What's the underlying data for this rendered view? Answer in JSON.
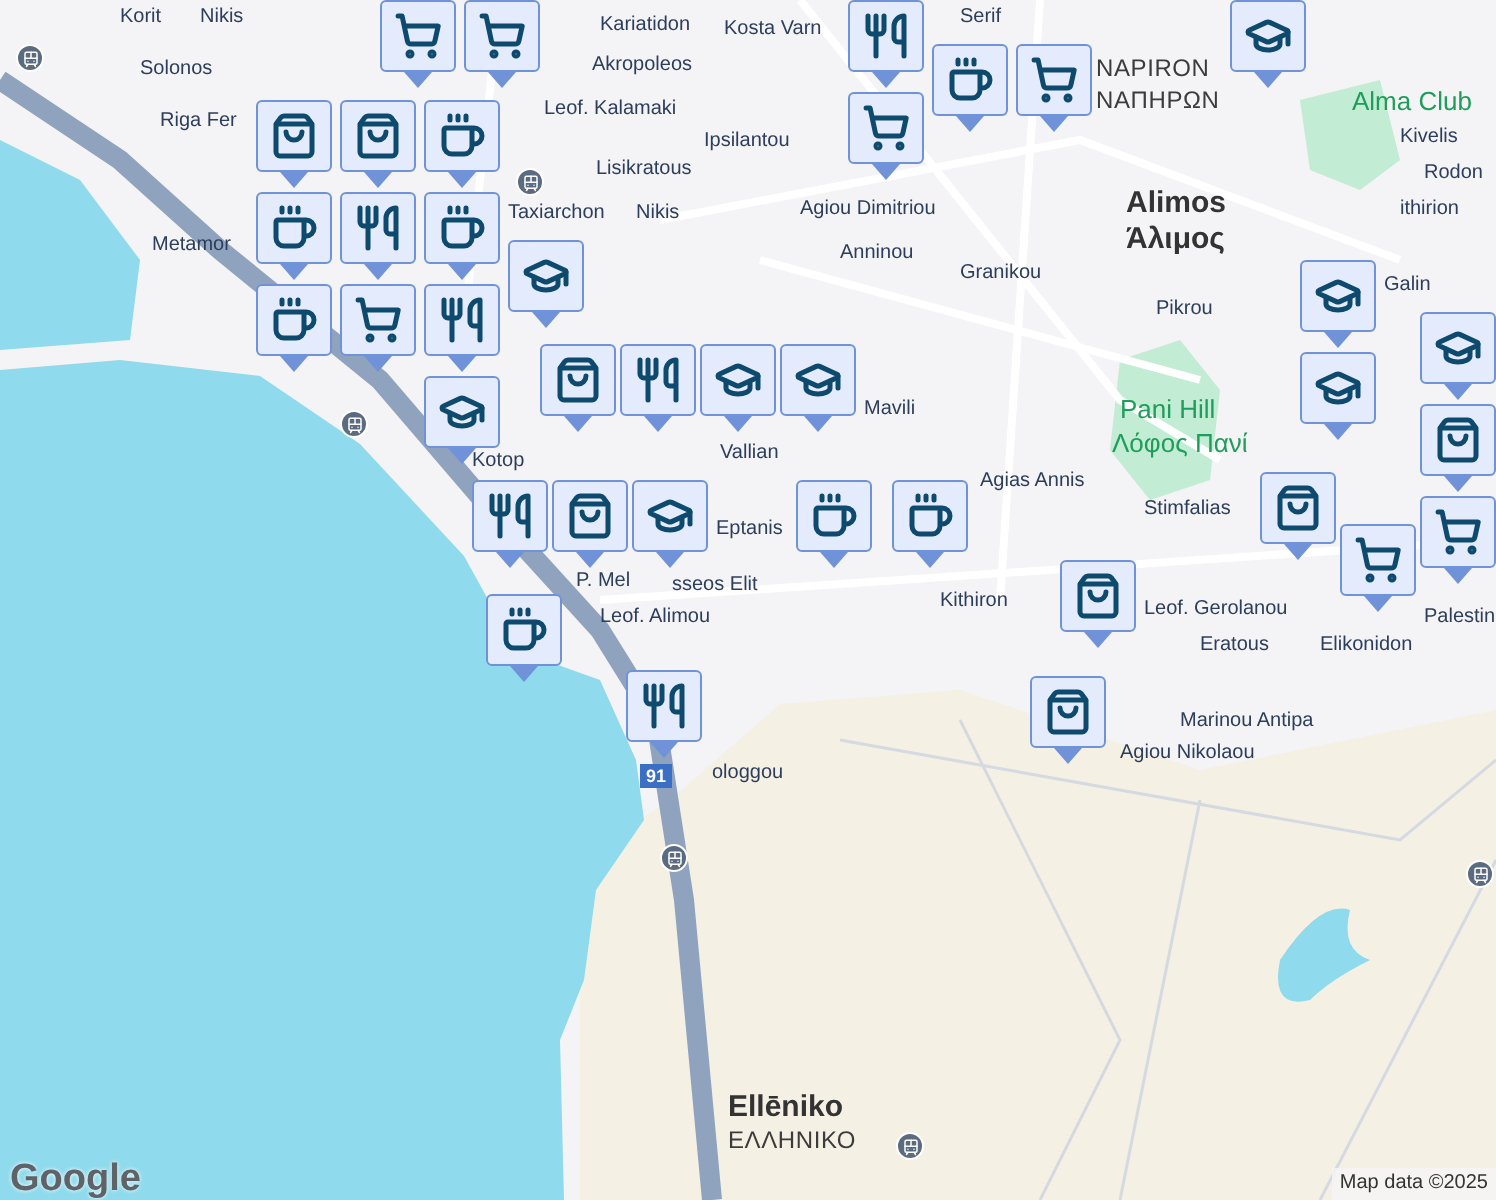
{
  "map": {
    "labels": [
      {
        "text": "Korit",
        "kind": "street"
      },
      {
        "text": "Nikis",
        "kind": "street"
      },
      {
        "text": "Solonos",
        "kind": "street"
      },
      {
        "text": "Riga Fer",
        "kind": "street"
      },
      {
        "text": "Metamor",
        "kind": "street"
      },
      {
        "text": "Leof. Kalamaki",
        "kind": "street"
      },
      {
        "text": "Lisikratous",
        "kind": "street"
      },
      {
        "text": "Taxiarchon",
        "kind": "street"
      },
      {
        "text": "Nikis",
        "kind": "street"
      },
      {
        "text": "Ipsilantou",
        "kind": "street"
      },
      {
        "text": "Kariatidon",
        "kind": "street"
      },
      {
        "text": "Akropoleos",
        "kind": "street"
      },
      {
        "text": "Kosta Varn",
        "kind": "street"
      },
      {
        "text": "Agiou Dimitriou",
        "kind": "street"
      },
      {
        "text": "Anninou",
        "kind": "street"
      },
      {
        "text": "Granikou",
        "kind": "street"
      },
      {
        "text": "NAPIRON",
        "kind": "district"
      },
      {
        "text": "ΝΑΠΗΡΩΝ",
        "kind": "district"
      },
      {
        "text": "Alimos",
        "kind": "town"
      },
      {
        "text": "Άλιμος",
        "kind": "town"
      },
      {
        "text": "Pikrou",
        "kind": "street"
      },
      {
        "text": "Alma Club",
        "kind": "park"
      },
      {
        "text": "Kivelis",
        "kind": "street"
      },
      {
        "text": "Rodon",
        "kind": "street"
      },
      {
        "text": "ithirion",
        "kind": "street"
      },
      {
        "text": "Galin",
        "kind": "street"
      },
      {
        "text": "Pani Hill",
        "kind": "park"
      },
      {
        "text": "Λόφος Πανί",
        "kind": "park"
      },
      {
        "text": "Agias Annis",
        "kind": "street"
      },
      {
        "text": "Stimfalias",
        "kind": "street"
      },
      {
        "text": "Vallian",
        "kind": "street"
      },
      {
        "text": "Kotop",
        "kind": "street"
      },
      {
        "text": "Leof. Alimou",
        "kind": "street"
      },
      {
        "text": "Kithiron",
        "kind": "street"
      },
      {
        "text": "Leof. Gerolanou",
        "kind": "street"
      },
      {
        "text": "Eratous",
        "kind": "street"
      },
      {
        "text": "Marinou Antipa",
        "kind": "street"
      },
      {
        "text": "Agiou Nikolaou",
        "kind": "street"
      },
      {
        "text": "Elikonidon",
        "kind": "street"
      },
      {
        "text": "Palestin",
        "kind": "street"
      },
      {
        "text": "ologgou",
        "kind": "street"
      },
      {
        "text": "Ellēniko",
        "kind": "town"
      },
      {
        "text": "ΕΛΛΗΝΙΚΟ",
        "kind": "district"
      },
      {
        "text": "Serif",
        "kind": "street"
      },
      {
        "text": "Mavili",
        "kind": "street"
      },
      {
        "text": "Eptanis",
        "kind": "street"
      },
      {
        "text": "sseos Elit",
        "kind": "street"
      },
      {
        "text": "P. Mel",
        "kind": "street"
      }
    ],
    "route_shield": "91",
    "markers": [
      {
        "kind": "cart"
      },
      {
        "kind": "cart"
      },
      {
        "kind": "fork"
      },
      {
        "kind": "cart"
      },
      {
        "kind": "cup"
      },
      {
        "kind": "cart"
      },
      {
        "kind": "cap"
      },
      {
        "kind": "bag"
      },
      {
        "kind": "bag"
      },
      {
        "kind": "cup"
      },
      {
        "kind": "cup"
      },
      {
        "kind": "fork"
      },
      {
        "kind": "cup"
      },
      {
        "kind": "cup"
      },
      {
        "kind": "cart"
      },
      {
        "kind": "fork"
      },
      {
        "kind": "cap"
      },
      {
        "kind": "cap"
      },
      {
        "kind": "bag"
      },
      {
        "kind": "fork"
      },
      {
        "kind": "cap"
      },
      {
        "kind": "cap"
      },
      {
        "kind": "cap"
      },
      {
        "kind": "cap"
      },
      {
        "kind": "cap"
      },
      {
        "kind": "bag"
      },
      {
        "kind": "bag"
      },
      {
        "kind": "cart"
      },
      {
        "kind": "cart"
      },
      {
        "kind": "fork"
      },
      {
        "kind": "bag"
      },
      {
        "kind": "cap"
      },
      {
        "kind": "cup"
      },
      {
        "kind": "cup"
      },
      {
        "kind": "bag"
      },
      {
        "kind": "bag"
      },
      {
        "kind": "cup"
      },
      {
        "kind": "fork"
      }
    ],
    "logo": "Google",
    "attribution": "Map data ©2025"
  }
}
